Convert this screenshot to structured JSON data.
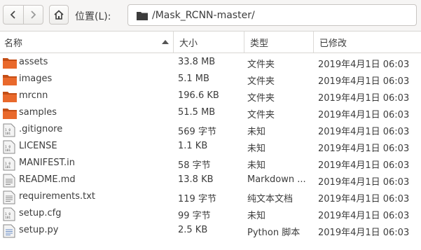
{
  "toolbar": {
    "location_label": "位置(L):",
    "path": "/Mask_RCNN-master/"
  },
  "columns": {
    "name": "名称",
    "size": "大小",
    "type": "类型",
    "modified": "已修改"
  },
  "colors": {
    "folder_orange": "#e9692c",
    "folder_dark": "#c44e16"
  },
  "files": [
    {
      "name": "assets",
      "size": "33.8 MB",
      "type": "文件夹",
      "modified": "2019年4月1日 06:03",
      "icon": "folder-icon"
    },
    {
      "name": "images",
      "size": "5.1 MB",
      "type": "文件夹",
      "modified": "2019年4月1日 06:03",
      "icon": "folder-icon"
    },
    {
      "name": "mrcnn",
      "size": "196.6 KB",
      "type": "文件夹",
      "modified": "2019年4月1日 06:03",
      "icon": "folder-icon"
    },
    {
      "name": "samples",
      "size": "51.5 MB",
      "type": "文件夹",
      "modified": "2019年4月1日 06:03",
      "icon": "folder-icon"
    },
    {
      "name": ".gitignore",
      "size": "569 字节",
      "type": "未知",
      "modified": "2019年4月1日 06:03",
      "icon": "binary-file-icon"
    },
    {
      "name": "LICENSE",
      "size": "1.1 KB",
      "type": "未知",
      "modified": "2019年4月1日 06:03",
      "icon": "binary-file-icon"
    },
    {
      "name": "MANIFEST.in",
      "size": "58 字节",
      "type": "未知",
      "modified": "2019年4月1日 06:03",
      "icon": "binary-file-icon"
    },
    {
      "name": "README.md",
      "size": "13.8 KB",
      "type": "Markdown ...",
      "modified": "2019年4月1日 06:03",
      "icon": "text-file-icon"
    },
    {
      "name": "requirements.txt",
      "size": "119 字节",
      "type": "纯文本文档",
      "modified": "2019年4月1日 06:03",
      "icon": "text-file-icon"
    },
    {
      "name": "setup.cfg",
      "size": "99 字节",
      "type": "未知",
      "modified": "2019年4月1日 06:03",
      "icon": "binary-file-icon"
    },
    {
      "name": "setup.py",
      "size": "2.5 KB",
      "type": "Python 脚本",
      "modified": "2019年4月1日 06:03",
      "icon": "python-file-icon"
    }
  ]
}
